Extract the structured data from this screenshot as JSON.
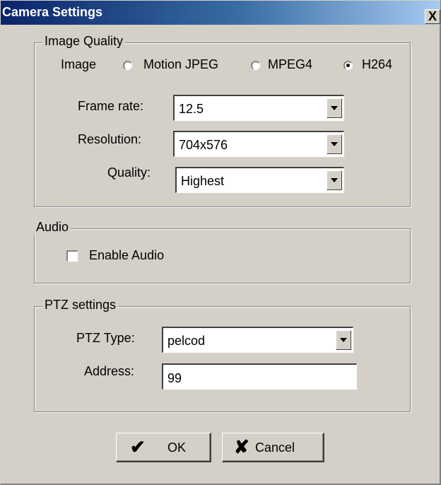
{
  "window": {
    "title": "Camera Settings",
    "close_label": "X"
  },
  "image_quality": {
    "legend": "Image Quality",
    "image_label": "Image",
    "formats": [
      {
        "label": "Motion JPEG",
        "selected": false
      },
      {
        "label": "MPEG4",
        "selected": false
      },
      {
        "label": "H264",
        "selected": true
      }
    ],
    "frame_rate": {
      "label": "Frame rate:",
      "value": "12.5"
    },
    "resolution": {
      "label": "Resolution:",
      "value": "704x576"
    },
    "quality": {
      "label": "Quality:",
      "value": "Highest"
    }
  },
  "audio": {
    "legend": "Audio",
    "enable_label": "Enable Audio",
    "enabled": false
  },
  "ptz": {
    "legend": "PTZ settings",
    "type": {
      "label": "PTZ Type:",
      "value": "pelcod"
    },
    "address": {
      "label": "Address:",
      "value": "99"
    }
  },
  "buttons": {
    "ok": {
      "label": "OK",
      "icon": "checkmark-icon"
    },
    "cancel": {
      "label": "Cancel",
      "icon": "x-icon"
    }
  }
}
